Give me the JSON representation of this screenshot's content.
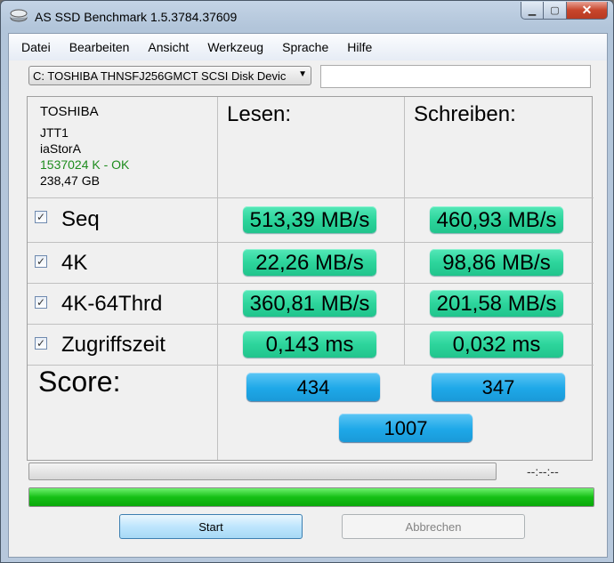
{
  "window": {
    "title": "AS SSD Benchmark 1.5.3784.37609"
  },
  "menu": [
    "Datei",
    "Bearbeiten",
    "Ansicht",
    "Werkzeug",
    "Sprache",
    "Hilfe"
  ],
  "drive": {
    "selected": "C: TOSHIBA THNSFJ256GMCT SCSI Disk Devic",
    "input_value": ""
  },
  "info": {
    "name": "TOSHIBA",
    "firmware": "JTT1",
    "driver": "iaStorA",
    "alignment": "1537024 K - OK",
    "size": "238,47 GB"
  },
  "headers": {
    "read": "Lesen:",
    "write": "Schreiben:"
  },
  "tests": [
    {
      "label": "Seq",
      "checked": true,
      "read": "513,39 MB/s",
      "write": "460,93 MB/s"
    },
    {
      "label": "4K",
      "checked": true,
      "read": "22,26 MB/s",
      "write": "98,86 MB/s"
    },
    {
      "label": "4K-64Thrd",
      "checked": true,
      "read": "360,81 MB/s",
      "write": "201,58 MB/s"
    },
    {
      "label": "Zugriffszeit",
      "checked": true,
      "read": "0,143 ms",
      "write": "0,032 ms"
    }
  ],
  "score": {
    "label": "Score:",
    "read": "434",
    "write": "347",
    "total": "1007"
  },
  "progress": {
    "elapsed": "--:--:--",
    "fraction": 1.0
  },
  "buttons": {
    "start": "Start",
    "cancel": "Abbrechen"
  },
  "colors": {
    "result_green": "#2dd59c",
    "score_blue": "#1ea8e8",
    "progress_green": "#16c016",
    "ok_green": "#1e8c1e"
  }
}
